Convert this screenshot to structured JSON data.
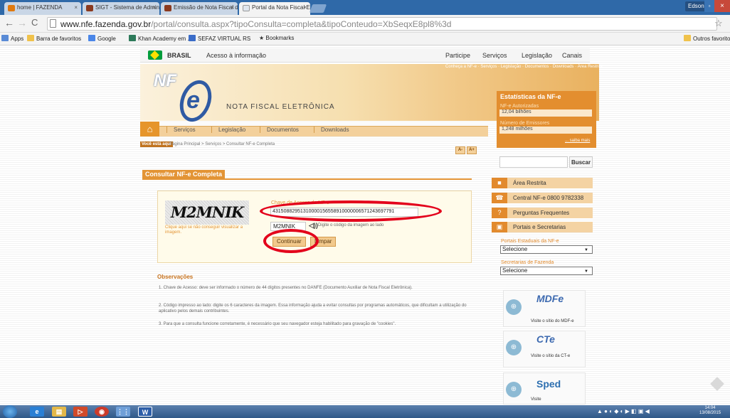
{
  "browser": {
    "tabs": [
      {
        "label": "home | FAZENDA",
        "fav": "#e07a10"
      },
      {
        "label": "SIGT - Sistema de Admin",
        "fav": "#8a3a1f"
      },
      {
        "label": "Emissão de Nota Fiscal de",
        "fav": "#8a3a1f"
      },
      {
        "label": "Portal da Nota Fiscal Eletr",
        "fav": "#dfe6ee"
      }
    ],
    "user": "Edson",
    "url_host": "www.nfe.fazenda.gov.br",
    "url_path": "/portal/consulta.aspx?tipoConsulta=completa&tipoConteudo=XbSeqxE8pl8%3d",
    "bookmarks": [
      "Apps",
      "Barra de favoritos",
      "Google",
      "Khan Academy em ...",
      "SEFAZ VIRTUAL RS",
      "Bookmarks"
    ],
    "other_bookmarks": "Outros favoritos"
  },
  "govbar": {
    "brasil": "BRASIL",
    "acesso": "Acesso à informação",
    "links": [
      "Participe",
      "Serviços",
      "Legislação",
      "Canais"
    ]
  },
  "header": {
    "logo": "NF",
    "logo_e": "e",
    "subtitle": "NOTA FISCAL ELETRÔNICA",
    "toplinks": "Conheça a NF-e · Serviços · Legislação · Documentos · Downloads · Área Restrita"
  },
  "menu": [
    "Serviços",
    "Legislação",
    "Documentos",
    "Downloads"
  ],
  "breadcrumb": {
    "you_are_here": "Você está aqui",
    "path": "Página Principal > Serviços > Consultar NF-e Completa"
  },
  "font_buttons": [
    "A-",
    "A+"
  ],
  "section_title": "Consultar NF-e Completa",
  "form": {
    "captcha_text": "M2MNIK",
    "captcha_help": "Clique aqui se não conseguir visualizar a imagem.",
    "chave_label": "Chave de Acesso da NF-e",
    "chave_value": "43150882951310000156558910000006571243697791",
    "code_value": "M2MNIK",
    "audio": "◁))",
    "code_hint": "Digite o código da imagem ao lado",
    "continuar": "Continuar",
    "limpar": "Limpar"
  },
  "observacoes": {
    "title": "Observações",
    "items": [
      "1. Chave de Acesso: deve ser informado o número de 44 dígitos presentes no DANFE (Documento Auxiliar de Nota Fiscal Eletrônica).",
      "2. Código impresso ao lado: digite os 6 caracteres da imagem. Essa informação ajuda a evitar consultas por programas automáticos, que dificultam a utilização do aplicativo pelos demais contribuintes.",
      "3. Para que a consulta funcione corretamente, é necessário que seu navegador esteja habilitado para gravação de \"cookies\"."
    ]
  },
  "sidebar": {
    "stats_title": "Estatísticas da NF-e",
    "autorizadas_label": "NF-e Autorizadas",
    "autorizadas_value": "12,04 bilhões",
    "emissores_label": "Número de Emissores",
    "emissores_value": "1,248 milhões",
    "saiba_mais": "... saiba mais",
    "buscar": "Buscar",
    "links": [
      {
        "label": "Área Restrita",
        "icon": "lock-icon",
        "glyph": "■"
      },
      {
        "label": "Central NF-e 0800 9782338",
        "icon": "phone-icon",
        "glyph": "☎"
      },
      {
        "label": "Perguntas Frequentes",
        "icon": "question-icon",
        "glyph": "?"
      },
      {
        "label": "Portais e Secretarias",
        "icon": "monitor-icon",
        "glyph": "▣"
      }
    ],
    "portais_label": "Portais Estaduais da NF-e",
    "portais_value": "Selecione",
    "secretarias_label": "Secretarias de Fazenda",
    "secretarias_value": "Selecione",
    "promos": [
      {
        "big": "MDFe",
        "text": "Visite o sítio do MDF-e"
      },
      {
        "big": "CTe",
        "text": "Visite o sítio da CT-e"
      },
      {
        "big": "Sped",
        "text": "Visite"
      }
    ]
  },
  "taskbar": {
    "time": "14:04",
    "date": "13/08/2015"
  },
  "colors": {
    "accent": "#e39435",
    "annotation_red": "#e3001b",
    "chrome_blue": "#2f69a8"
  }
}
